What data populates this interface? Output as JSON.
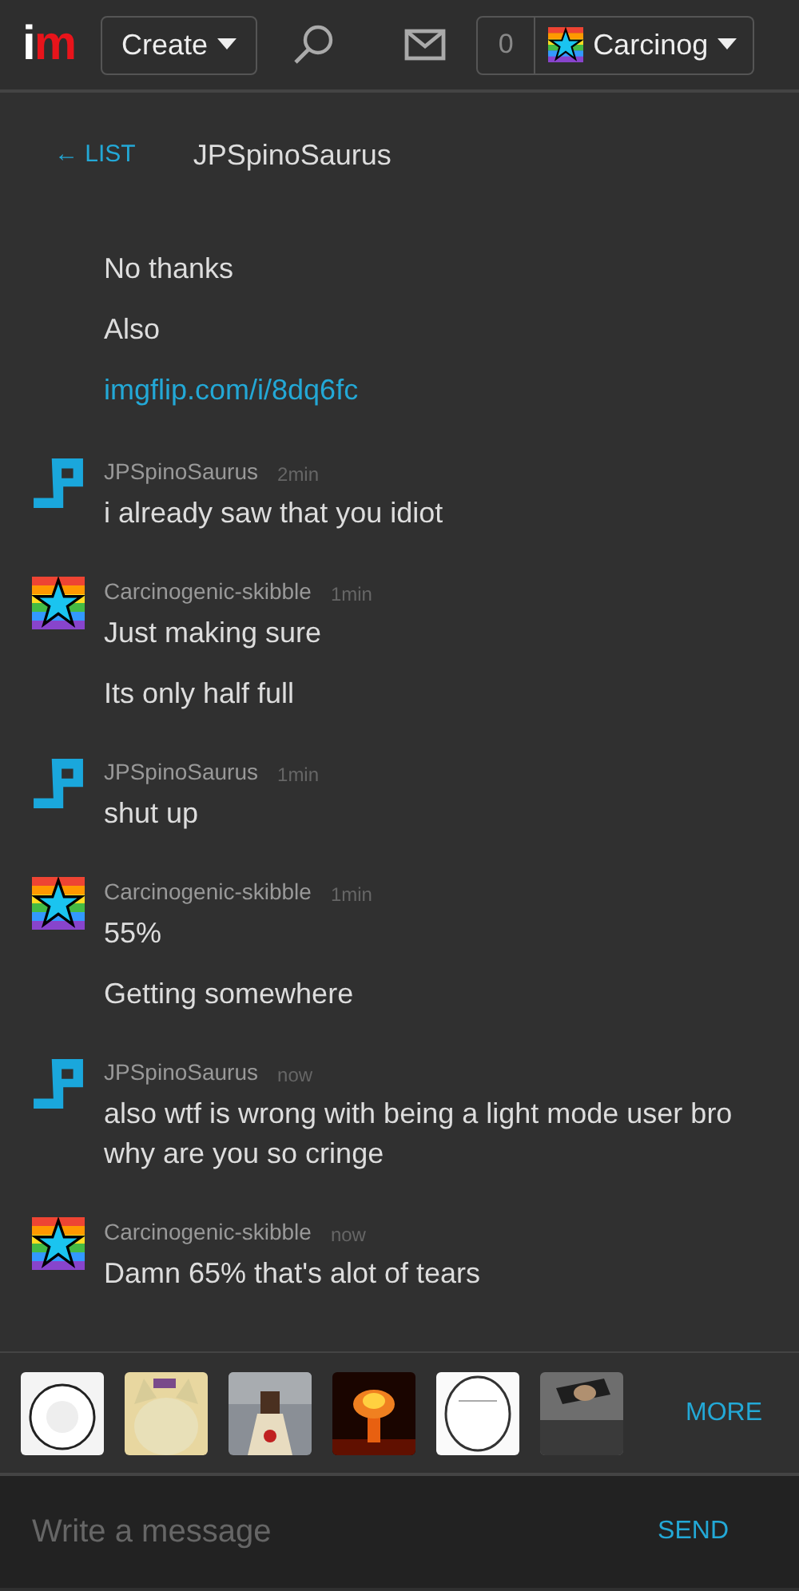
{
  "header": {
    "logo": "im",
    "create_button": "Create",
    "notification_count": "0",
    "user_menu": "Carcinog"
  },
  "chat": {
    "back_link": "← LIST",
    "title": "JPSpinoSaurus"
  },
  "messages": [
    {
      "kind": "continuation",
      "lines": [
        {
          "kind": "text",
          "text": "No thanks"
        },
        {
          "kind": "text",
          "text": "Also"
        },
        {
          "kind": "link",
          "text": "imgflip.com/i/8dq6fc"
        }
      ]
    },
    {
      "kind": "spino",
      "user": "JPSpinoSaurus",
      "time": "2min",
      "lines": [
        {
          "kind": "text",
          "text": "i already saw that you idiot"
        }
      ]
    },
    {
      "kind": "rainbow",
      "user": "Carcinogenic-skibble",
      "time": "1min",
      "lines": [
        {
          "kind": "text",
          "text": "Just making sure"
        },
        {
          "kind": "text",
          "text": "Its only half full"
        }
      ]
    },
    {
      "kind": "spino",
      "user": "JPSpinoSaurus",
      "time": "1min",
      "lines": [
        {
          "kind": "text",
          "text": "shut up"
        }
      ]
    },
    {
      "kind": "rainbow",
      "user": "Carcinogenic-skibble",
      "time": "1min",
      "lines": [
        {
          "kind": "text",
          "text": "55%"
        },
        {
          "kind": "text",
          "text": "Getting somewhere"
        }
      ]
    },
    {
      "kind": "spino",
      "user": "JPSpinoSaurus",
      "time": "now",
      "lines": [
        {
          "kind": "text",
          "text": "also wtf is wrong with being a light mode user bro why are you so cringe"
        }
      ]
    },
    {
      "kind": "rainbow",
      "user": "Carcinogenic-skibble",
      "time": "now",
      "lines": [
        {
          "kind": "text",
          "text": "Damn 65% that's alot of tears"
        }
      ]
    }
  ],
  "meme_picker": {
    "more_button": "MORE"
  },
  "composer": {
    "placeholder": "Write a message",
    "send_button": "SEND"
  }
}
